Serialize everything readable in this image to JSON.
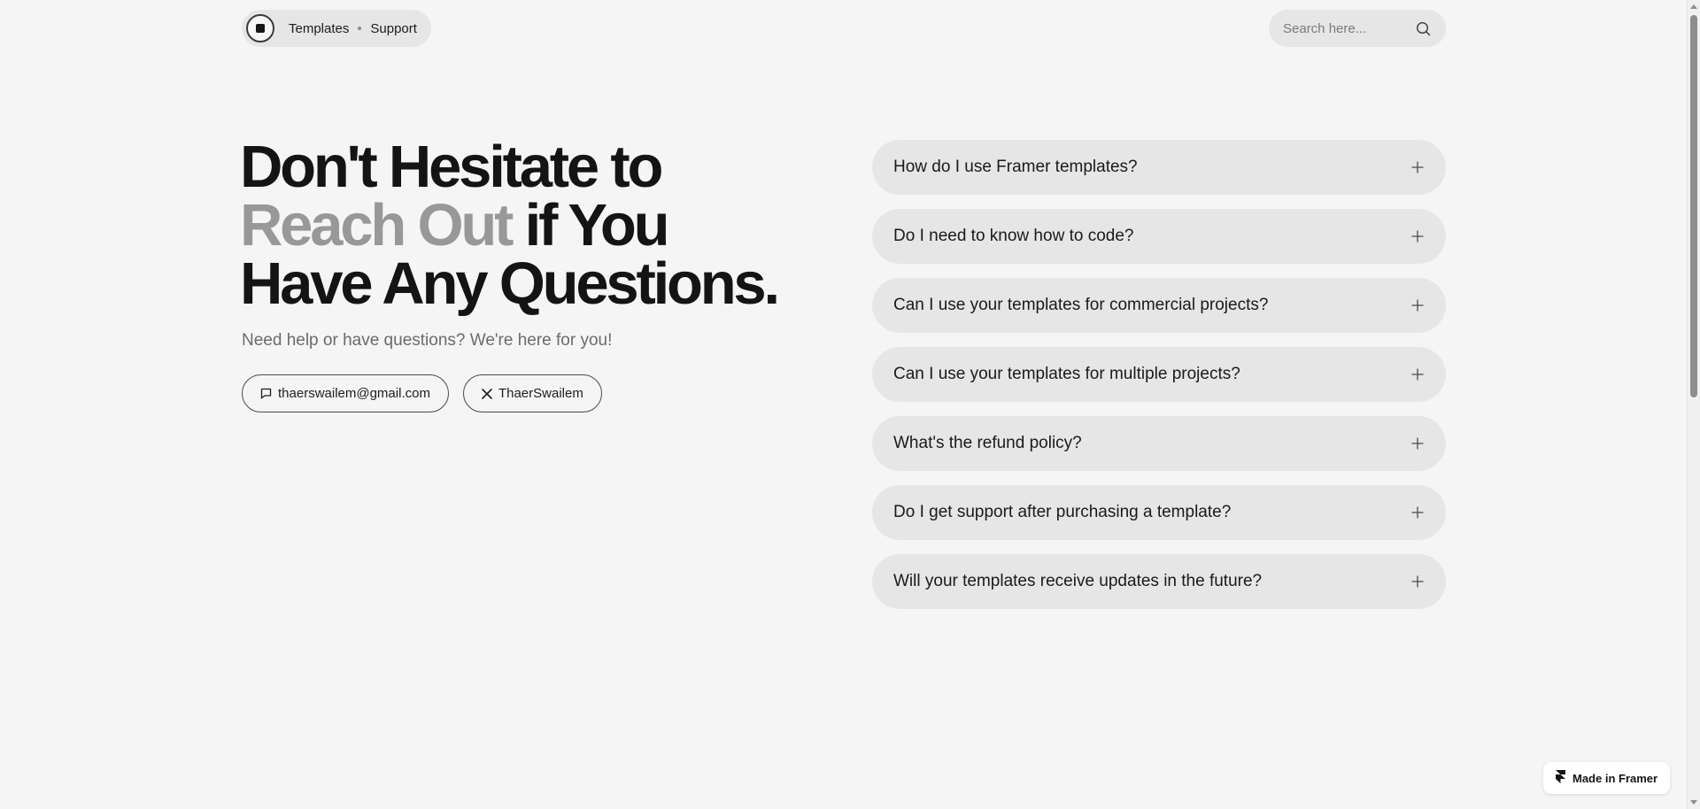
{
  "nav": {
    "logo_icon": "square-logo-icon",
    "links": [
      "Templates",
      "Support"
    ]
  },
  "search": {
    "placeholder": "Search here...",
    "icon": "search-icon"
  },
  "hero": {
    "title_line1": "Don't Hesitate to",
    "title_line2_muted": "Reach Out",
    "title_line2_rest": " if You",
    "title_line3": "Have Any Questions.",
    "subtitle": "Need help or have questions? We're here for you!",
    "email_label": "thaerswailem@gmail.com",
    "email_icon": "message-icon",
    "x_label": "ThaerSwailem",
    "x_icon": "x-logo-icon"
  },
  "faq": [
    "How do I use Framer templates?",
    "Do I need to know how to code?",
    "Can I use your templates for commercial projects?",
    "Can I use your templates for multiple projects?",
    "What's the refund policy?",
    "Do I get support after purchasing a template?",
    "Will your templates receive updates in the future?"
  ],
  "badge": {
    "label": "Made in Framer",
    "icon": "framer-logo-icon"
  },
  "colors": {
    "background": "#f5f5f5",
    "pill": "#e6e6e6",
    "text": "#141414",
    "muted": "#989898",
    "subtitle": "#6b6b6b"
  }
}
